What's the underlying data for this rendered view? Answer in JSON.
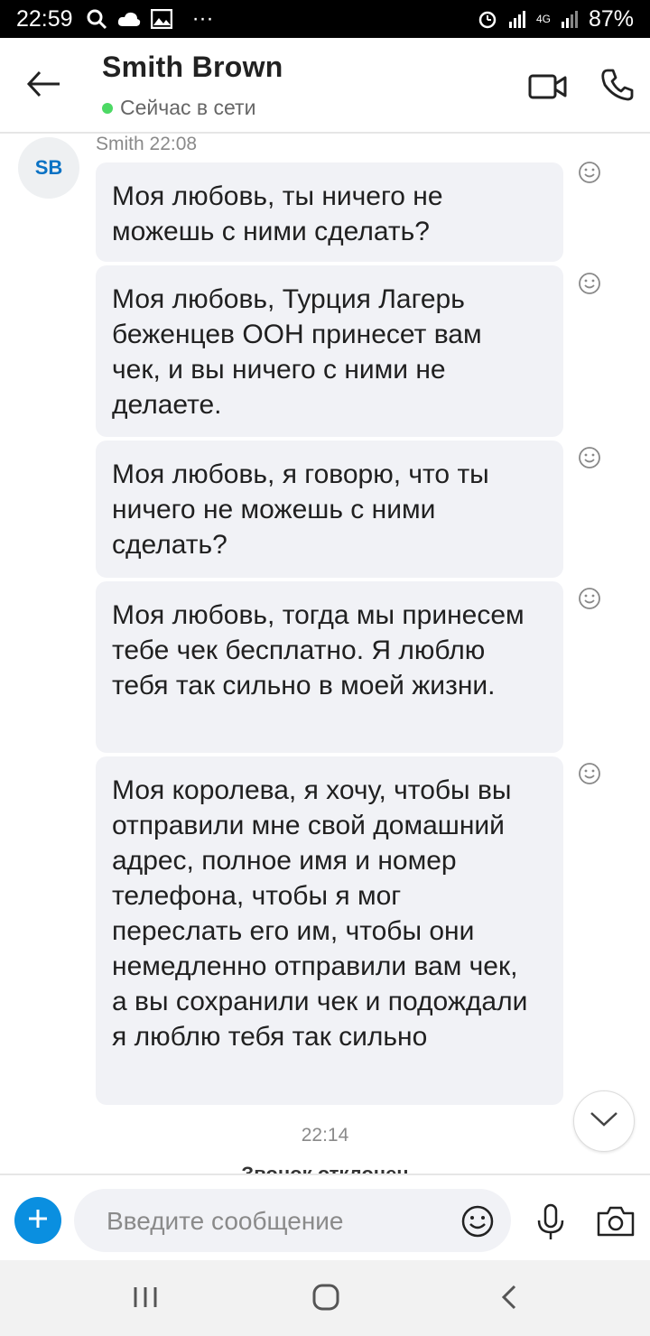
{
  "status_bar": {
    "time": "22:59",
    "dots": "···",
    "network": "4G",
    "battery": "87%",
    "left_icons": [
      "search-icon",
      "cloud-icon",
      "image-icon"
    ],
    "right_icons": [
      "alarm-icon",
      "signal-icon",
      "signal-icon",
      "battery-icon"
    ]
  },
  "header": {
    "contact_name": "Smith Brown",
    "presence": "Сейчас в сети",
    "presence_color": "#4cd964",
    "actions": [
      "video-call-icon",
      "phone-icon"
    ]
  },
  "chat": {
    "avatar_initials": "SB",
    "sender_meta": "Smith 22:08",
    "messages": [
      {
        "text": "Моя любовь, ты ничего не можешь с ними сделать?"
      },
      {
        "text": "Моя любовь, Турция Лагерь беженцев ООН принесет вам чек, и вы ничего с ними не делаете."
      },
      {
        "text": "Моя любовь, я говорю, что ты ничего не можешь с ними сделать?"
      },
      {
        "text": "Моя любовь, тогда мы принесем тебе чек бесплатно. Я люблю тебя так сильно в моей жизни."
      },
      {
        "text": "Моя королева, я хочу, чтобы вы отправили мне свой домашний адрес, полное имя и номер телефона, чтобы я мог переслать его им, чтобы они немедленно отправили вам чек, а вы сохранили чек и подождали я люблю тебя так сильно"
      }
    ],
    "time_separator": "22:14",
    "call_status": "Звонок отклонен"
  },
  "composer": {
    "placeholder": "Введите сообщение",
    "accent_color": "#0a8fe0"
  },
  "colors": {
    "bubble_bg": "#f1f2f6",
    "brand_blue": "#0a72c4"
  }
}
